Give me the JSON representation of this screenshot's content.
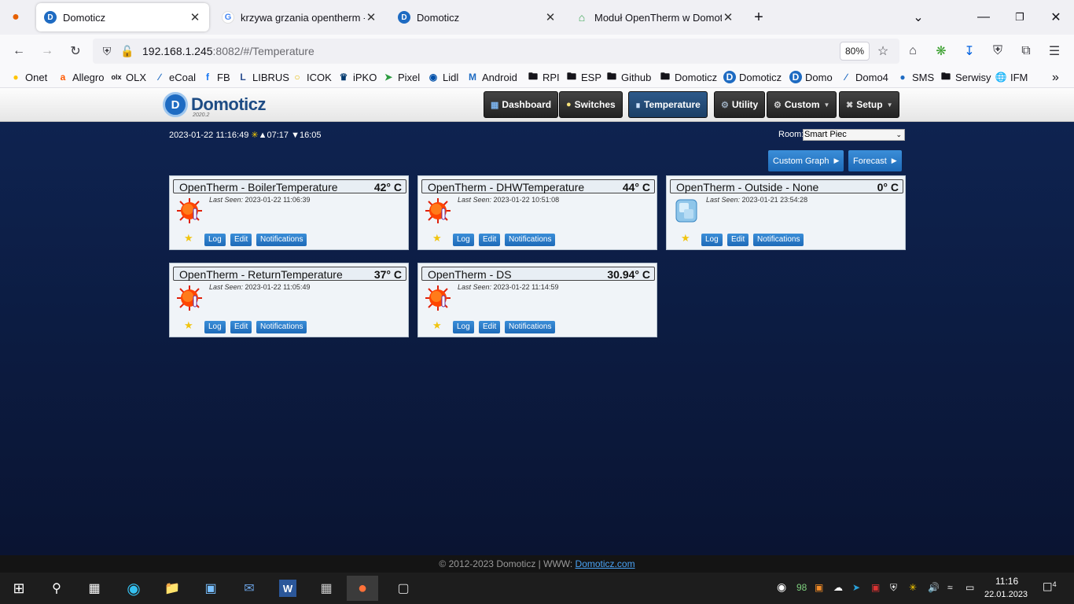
{
  "browser": {
    "tabs": [
      {
        "title": "Domoticz",
        "favicon": "domoticz-icon",
        "active": true
      },
      {
        "title": "krzywa grzania opentherm - Szu",
        "favicon": "google-icon",
        "active": false
      },
      {
        "title": "Domoticz",
        "favicon": "domoticz-icon",
        "active": false
      },
      {
        "title": "Moduł OpenTherm w Domoticz",
        "favicon": "home-icon",
        "active": false
      }
    ],
    "url_host": "192.168.1.245",
    "url_rest": ":8082/#/Temperature",
    "zoom": "80%",
    "bookmarks": [
      "Onet",
      "Allegro",
      "OLX",
      "eCoal",
      "FB",
      "LIBRUS",
      "ICOK",
      "iPKO",
      "Pixel",
      "Lidl",
      "Android",
      "RPI",
      "ESP",
      "Github",
      "Domoticz",
      "Domoticz",
      "Domo",
      "Domo4",
      "SMS",
      "Serwisy",
      "IFM"
    ]
  },
  "app": {
    "logo_text": "Domoticz",
    "logo_version": "2020.2",
    "menu": [
      {
        "label": "Dashboard",
        "icon": "dashboard-icon"
      },
      {
        "label": "Switches",
        "icon": "bulb-icon"
      },
      {
        "label": "Temperature",
        "icon": "thermometer-icon"
      },
      {
        "label": "Utility",
        "icon": "utility-icon"
      },
      {
        "label": "Custom",
        "icon": "gear-icon"
      },
      {
        "label": "Setup",
        "icon": "tools-icon"
      }
    ],
    "datetime": "2023-01-22 11:16:49",
    "sunrise": "07:17",
    "sunset": "16:05",
    "room_label": "Room:",
    "room_value": "Smart Piec",
    "custom_graph_label": "Custom Graph",
    "forecast_label": "Forecast",
    "last_seen_label": "Last Seen:",
    "buttons": {
      "log": "Log",
      "edit": "Edit",
      "notifications": "Notifications"
    },
    "devices": [
      {
        "name": "OpenTherm - BoilerTemperature",
        "value": "42° C",
        "last_seen": "2023-01-22 11:06:39",
        "icon": "heat-icon"
      },
      {
        "name": "OpenTherm - DHWTemperature",
        "value": "44° C",
        "last_seen": "2023-01-22 10:51:08",
        "icon": "heat-icon"
      },
      {
        "name": "OpenTherm - Outside - None",
        "value": "0° C",
        "last_seen": "2023-01-21 23:54:28",
        "icon": "ice-icon"
      },
      {
        "name": "OpenTherm - ReturnTemperature",
        "value": "37° C",
        "last_seen": "2023-01-22 11:05:49",
        "icon": "heat-icon"
      },
      {
        "name": "OpenTherm - DS",
        "value": "30.94° C",
        "last_seen": "2023-01-22 11:14:59",
        "icon": "heat-icon"
      }
    ],
    "footer_text": "© 2012-2023 Domoticz | WWW: ",
    "footer_link": "Domoticz.com"
  },
  "taskbar": {
    "tray_number": "98",
    "time": "11:16",
    "date": "22.01.2023",
    "notification_count": "4"
  }
}
